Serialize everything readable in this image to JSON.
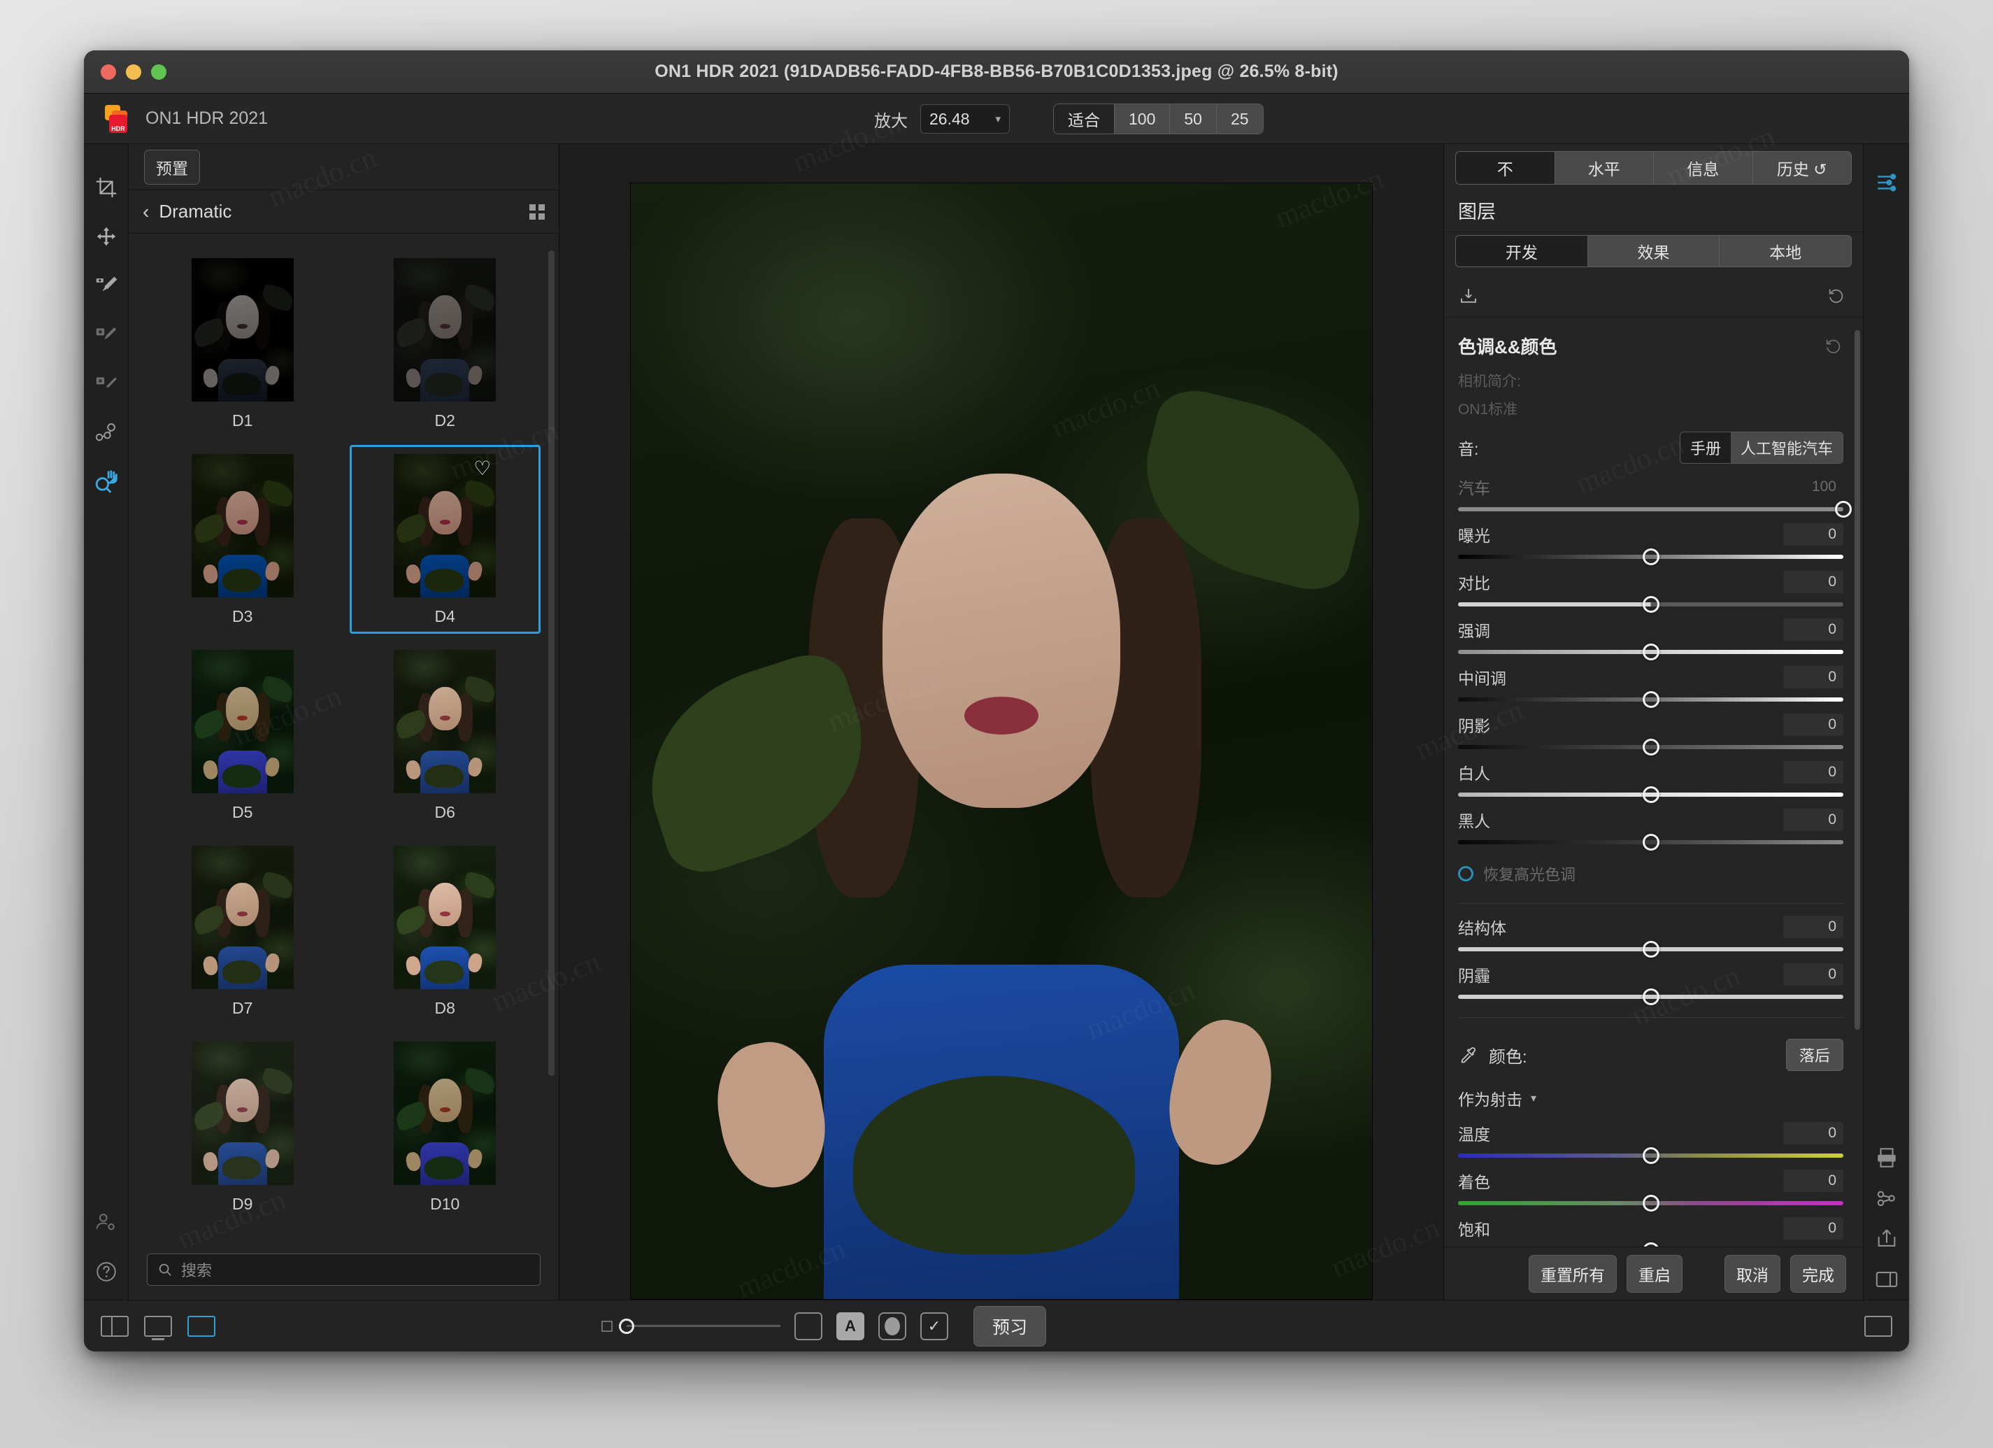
{
  "window": {
    "title": "ON1 HDR 2021 (91DADB56-FADD-4FB8-BB56-B70B1C0D1353.jpeg @ 26.5% 8-bit)",
    "app_name": "ON1 HDR 2021",
    "logo_badge": "HDR"
  },
  "toolbar": {
    "zoom_label": "放大",
    "zoom_value": "26.48",
    "fit_label": "适合",
    "zoom_presets": [
      "100",
      "50",
      "25"
    ]
  },
  "presets_panel": {
    "presets_button": "预置",
    "breadcrumb_back": "‹",
    "category": "Dramatic",
    "search_placeholder": "搜索",
    "items": [
      {
        "label": "D1",
        "variant": "v-mono",
        "favorite": false
      },
      {
        "label": "D2",
        "variant": "v-dark",
        "favorite": false
      },
      {
        "label": "D3",
        "variant": "v-cool",
        "favorite": false
      },
      {
        "label": "D4",
        "variant": "v-cool",
        "favorite": true
      },
      {
        "label": "D5",
        "variant": "v-teal",
        "favorite": false
      },
      {
        "label": "D6",
        "variant": "v-warm",
        "favorite": false
      },
      {
        "label": "D7",
        "variant": "v-warm",
        "favorite": false
      },
      {
        "label": "D8",
        "variant": "v-brite",
        "favorite": false
      },
      {
        "label": "D9",
        "variant": "v-soft",
        "favorite": false
      },
      {
        "label": "D10",
        "variant": "v-teal",
        "favorite": false
      }
    ],
    "selected": "D4",
    "selection_color": "#2b9fd6"
  },
  "right_panel": {
    "tabs": [
      {
        "label": "不",
        "active": true
      },
      {
        "label": "水平",
        "active": false
      },
      {
        "label": "信息",
        "active": false
      },
      {
        "label": "历史 ↺",
        "active": false
      }
    ],
    "layers_title": "图层",
    "subtabs": [
      {
        "label": "开发",
        "active": true
      },
      {
        "label": "效果",
        "active": false
      },
      {
        "label": "本地",
        "active": false
      }
    ],
    "section": {
      "title": "色调&&颜色",
      "camera_profile_label": "相机简介:",
      "camera_profile_value": "ON1标准",
      "tone_label": "音:",
      "tone_modes": [
        {
          "label": "手册",
          "active": true
        },
        {
          "label": "人工智能汽车",
          "active": false
        }
      ]
    },
    "sliders": [
      {
        "name": "汽车",
        "value": "100",
        "pos": 100,
        "track": "grad-auto",
        "dim": true,
        "boxed": false
      },
      {
        "name": "曝光",
        "value": "0",
        "pos": 50,
        "track": "grad-exp",
        "dim": false,
        "boxed": true
      },
      {
        "name": "对比",
        "value": "0",
        "pos": 50,
        "track": "grad-con",
        "dim": false,
        "boxed": true
      },
      {
        "name": "强调",
        "value": "0",
        "pos": 50,
        "track": "grad-hi",
        "dim": false,
        "boxed": true
      },
      {
        "name": "中间调",
        "value": "0",
        "pos": 50,
        "track": "grad-mid",
        "dim": false,
        "boxed": true
      },
      {
        "name": "阴影",
        "value": "0",
        "pos": 50,
        "track": "grad-sh",
        "dim": false,
        "boxed": true
      },
      {
        "name": "白人",
        "value": "0",
        "pos": 50,
        "track": "grad-wh",
        "dim": false,
        "boxed": true
      },
      {
        "name": "黑人",
        "value": "0",
        "pos": 50,
        "track": "grad-bk",
        "dim": false,
        "boxed": true
      }
    ],
    "highlight_checkbox": "恢复高光色调",
    "sliders2": [
      {
        "name": "结构体",
        "value": "0",
        "pos": 50,
        "track": "grad-plain",
        "dim": false,
        "boxed": true
      },
      {
        "name": "阴霾",
        "value": "0",
        "pos": 50,
        "track": "grad-plain",
        "dim": false,
        "boxed": true
      }
    ],
    "color": {
      "title": "颜色:",
      "reset_button": "落后",
      "dropdown_value": "作为射击",
      "sliders": [
        {
          "name": "温度",
          "value": "0",
          "pos": 50,
          "track": "grad-temp",
          "dim": false,
          "boxed": true
        },
        {
          "name": "着色",
          "value": "0",
          "pos": 50,
          "track": "grad-tint",
          "dim": false,
          "boxed": true
        },
        {
          "name": "饱和",
          "value": "0",
          "pos": 50,
          "track": "grad-sat",
          "dim": false,
          "boxed": true
        }
      ]
    },
    "footer_buttons": [
      "重置所有",
      "重启",
      "取消",
      "完成"
    ]
  },
  "bottom_bar": {
    "opacity_value": "0",
    "view_toggles": [
      "square",
      "A",
      "circle",
      "check"
    ],
    "active_toggle": "A",
    "preview_button": "预习"
  },
  "watermark": "macdo.cn"
}
